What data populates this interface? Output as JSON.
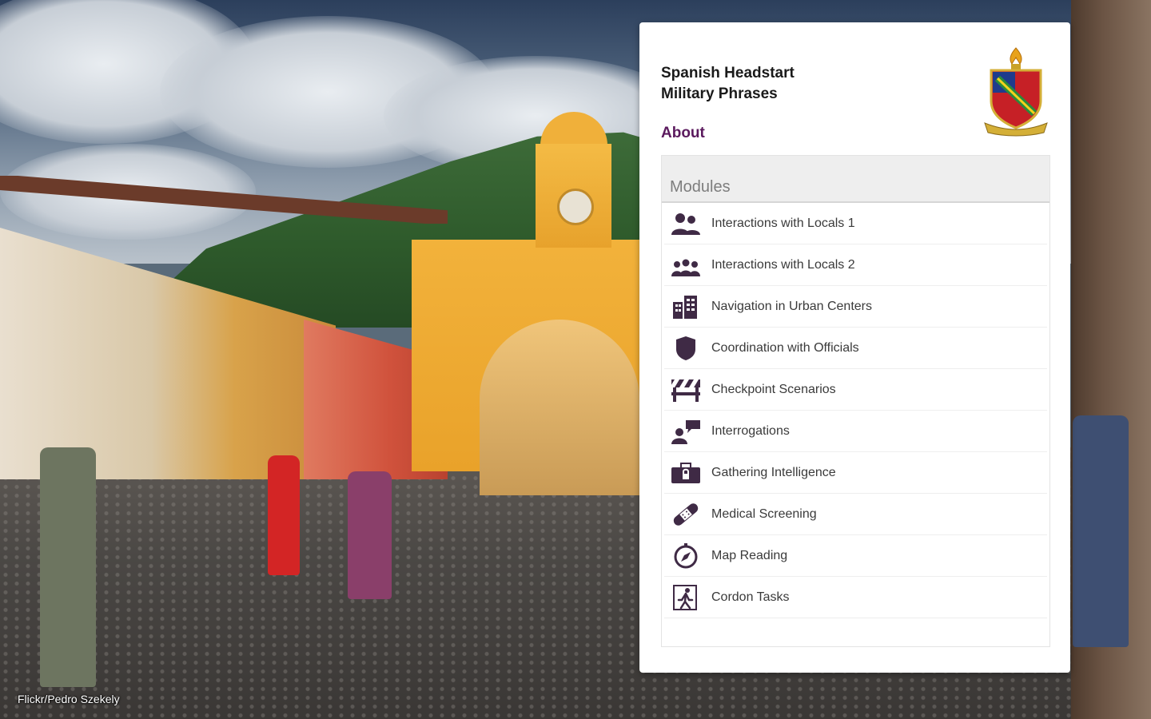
{
  "background": {
    "credit": "Flickr/Pedro Szekely"
  },
  "panel": {
    "title_line1": "Spanish Headstart",
    "title_line2": "Military Phrases",
    "about_label": "About",
    "crest_icon": "regimental-crest-icon"
  },
  "modules": {
    "header": "Modules",
    "items": [
      {
        "label": "Interactions with Locals 1",
        "icon": "people-group-icon"
      },
      {
        "label": "Interactions with Locals 2",
        "icon": "people-crowd-icon"
      },
      {
        "label": "Navigation in Urban Centers",
        "icon": "buildings-icon"
      },
      {
        "label": "Coordination with Officials",
        "icon": "shield-badge-icon"
      },
      {
        "label": "Checkpoint Scenarios",
        "icon": "barrier-icon"
      },
      {
        "label": "Interrogations",
        "icon": "speech-person-icon"
      },
      {
        "label": "Gathering Intelligence",
        "icon": "briefcase-lock-icon"
      },
      {
        "label": "Medical Screening",
        "icon": "bandage-icon"
      },
      {
        "label": "Map Reading",
        "icon": "compass-icon"
      },
      {
        "label": "Cordon Tasks",
        "icon": "cordon-runner-icon"
      }
    ]
  },
  "colors": {
    "accent": "#5b1a5e",
    "icon": "#3f2a45"
  }
}
